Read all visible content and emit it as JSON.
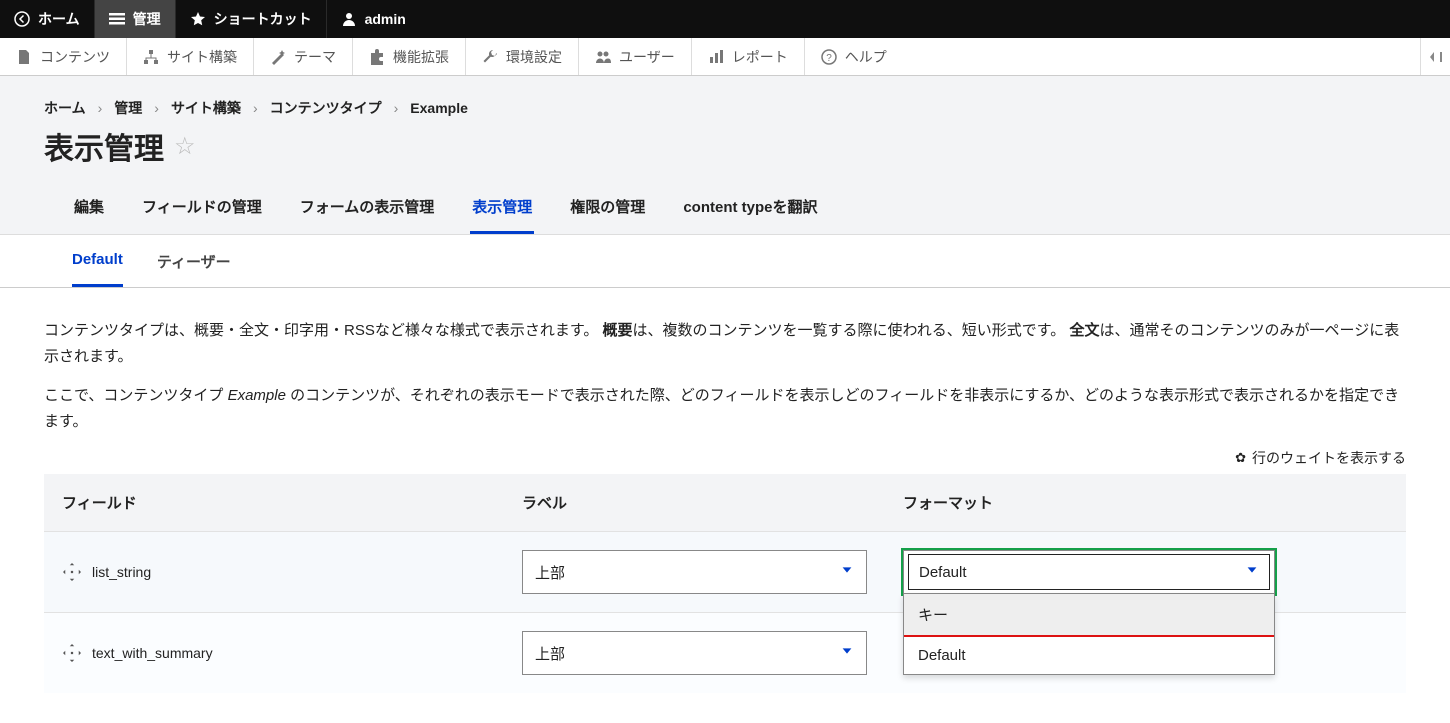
{
  "topbar": {
    "home": "ホーム",
    "admin": "管理",
    "shortcuts": "ショートカット",
    "user": "admin"
  },
  "adminmenu": {
    "content": "コンテンツ",
    "structure": "サイト構築",
    "appearance": "テーマ",
    "extend": "機能拡張",
    "config": "環境設定",
    "people": "ユーザー",
    "reports": "レポート",
    "help": "ヘルプ"
  },
  "breadcrumb": {
    "items": [
      "ホーム",
      "管理",
      "サイト構築",
      "コンテンツタイプ",
      "Example"
    ],
    "sep": "›"
  },
  "page_title": "表示管理",
  "primary_tabs": {
    "edit": "編集",
    "fields": "フィールドの管理",
    "form_display": "フォームの表示管理",
    "display": "表示管理",
    "perms": "権限の管理",
    "translate": "content typeを翻訳"
  },
  "secondary_tabs": {
    "default": "Default",
    "teaser": "ティーザー"
  },
  "intro": {
    "p1_a": "コンテンツタイプは、概要・全文・印字用・RSSなど様々な様式で表示されます。",
    "p1_b_bold": "概要",
    "p1_c": "は、複数のコンテンツを一覧する際に使われる、短い形式です。",
    "p1_d_bold": "全文",
    "p1_e": "は、通常そのコンテンツのみが一ページに表示されます。",
    "p2_a": "ここで、コンテンツタイプ ",
    "p2_b_italic": "Example",
    "p2_c": " のコンテンツが、それぞれの表示モードで表示された際、どのフィールドを表示しどのフィールドを非表示にするか、どのような表示形式で表示されるかを指定できます。"
  },
  "show_weights": "行のウェイトを表示する",
  "table": {
    "headers": {
      "field": "フィールド",
      "label": "ラベル",
      "format": "フォーマット"
    },
    "rows": [
      {
        "name": "list_string",
        "label_value": "上部",
        "format_value": "Default"
      },
      {
        "name": "text_with_summary",
        "label_value": "上部",
        "format_value": ""
      }
    ]
  },
  "dropdown": {
    "opt_key": "キー",
    "opt_default": "Default"
  }
}
